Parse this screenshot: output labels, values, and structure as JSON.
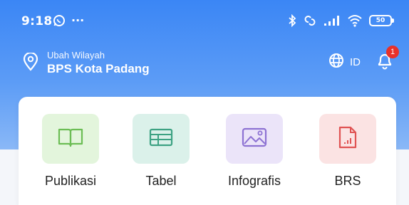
{
  "status_bar": {
    "time": "9:18",
    "overflow": "···",
    "battery": "50",
    "icons": [
      "whatsapp-icon",
      "bluetooth-icon",
      "link-icon",
      "signal-icon",
      "wifi-icon",
      "battery-icon"
    ]
  },
  "location": {
    "caption": "Ubah Wilayah",
    "name": "BPS Kota Padang",
    "icon": "location-pin-icon"
  },
  "language": {
    "label": "ID",
    "icon": "globe-icon"
  },
  "notifications": {
    "count": "1",
    "icon": "bell-icon"
  },
  "menu": {
    "items": [
      {
        "label": "Publikasi",
        "icon": "book-icon",
        "bg": "#e3f5dc",
        "color": "#6cbd55"
      },
      {
        "label": "Tabel",
        "icon": "table-icon",
        "bg": "#dbf1ea",
        "color": "#3da283"
      },
      {
        "label": "Infografis",
        "icon": "image-icon",
        "bg": "#ebe4f9",
        "color": "#8d72d3"
      },
      {
        "label": "BRS",
        "icon": "document-chart-icon",
        "bg": "#fbe3e3",
        "color": "#e05353"
      }
    ]
  },
  "colors": {
    "header_top": "#3b86f5",
    "header_bottom": "#8ab8f7",
    "badge": "#e8312a"
  }
}
